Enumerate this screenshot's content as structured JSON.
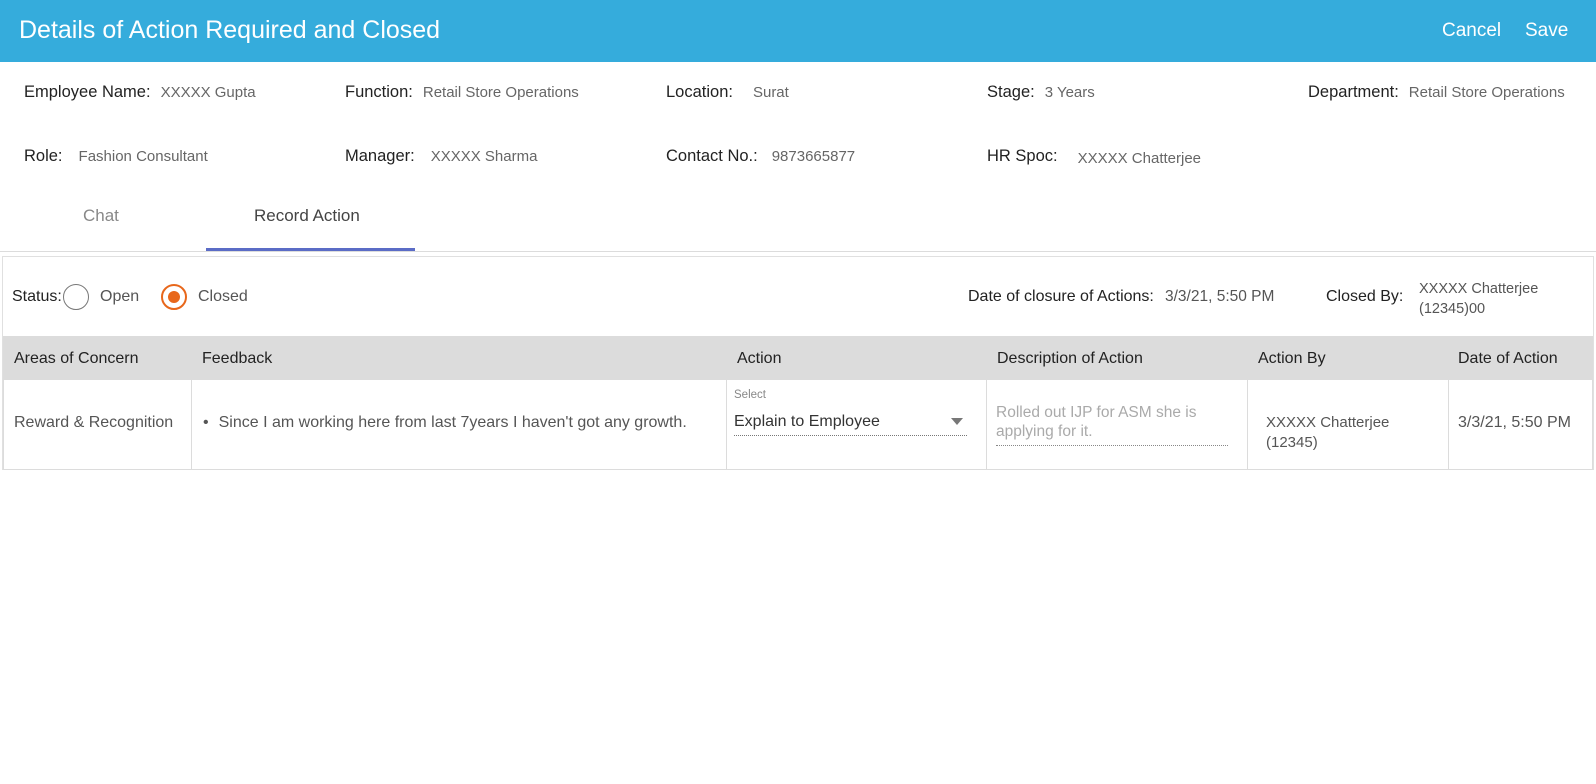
{
  "header": {
    "title": "Details of Action Required and Closed",
    "cancel_label": "Cancel",
    "save_label": "Save"
  },
  "employee": {
    "name_label": "Employee Name:",
    "name": "XXXXX Gupta",
    "function_label": "Function:",
    "function": "Retail Store Operations",
    "location_label": "Location:",
    "location": "Surat",
    "stage_label": "Stage:",
    "stage": "3 Years",
    "department_label": "Department:",
    "department": "Retail Store Operations",
    "role_label": "Role:",
    "role": "Fashion Consultant",
    "manager_label": "Manager:",
    "manager": "XXXXX Sharma",
    "contact_label": "Contact No.:",
    "contact": "9873665877",
    "hr_label": "HR Spoc:",
    "hr": "XXXXX Chatterjee"
  },
  "tabs": [
    {
      "label": "Chat",
      "active": false
    },
    {
      "label": "Record Action",
      "active": true
    }
  ],
  "status": {
    "label": "Status:",
    "options": [
      {
        "label": "Open",
        "checked": false
      },
      {
        "label": "Closed",
        "checked": true
      }
    ],
    "closure_label": "Date of closure of Actions:",
    "closure_value": "3/3/21, 5:50 PM",
    "closed_by_label": "Closed By:",
    "closed_by_value": "XXXXX Chatterjee (12345)00"
  },
  "table": {
    "columns": [
      "Areas of Concern",
      "Feedback",
      "Action",
      "Description of Action",
      "Action By",
      "Date of Action"
    ],
    "rows": [
      {
        "area": "Reward & Recognition",
        "feedback": "Since I am working here from last 7years I haven't got any growth.",
        "action_select_label": "Select",
        "action": "Explain to Employee",
        "description": "Rolled out IJP for ASM she is applying for it.",
        "action_by": "XXXXX Chatterjee (12345)",
        "date": "3/3/21, 5:50 PM"
      }
    ]
  },
  "colors": {
    "header_bg": "#35acdc",
    "accent_radio": "#e8671b",
    "tab_underline": "#5b6cc6",
    "table_header_bg": "#dcdcdc"
  }
}
